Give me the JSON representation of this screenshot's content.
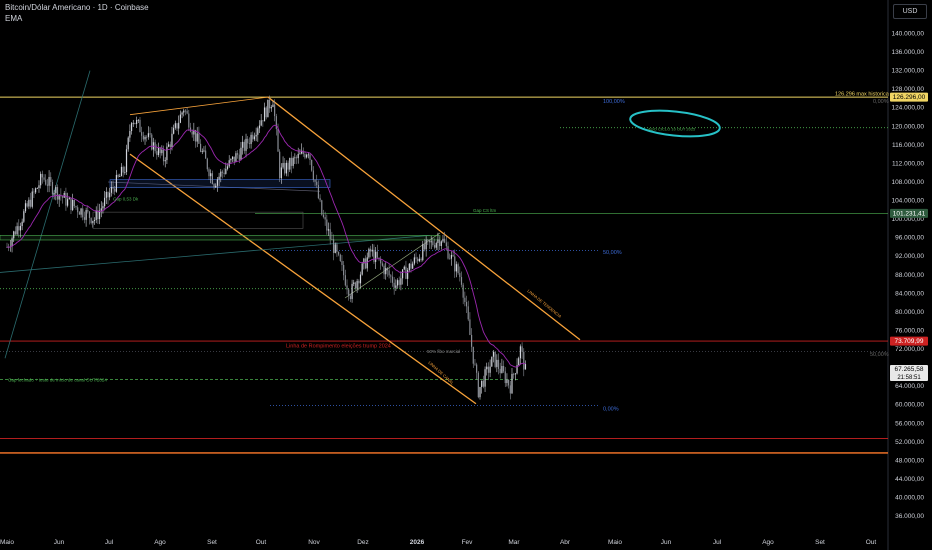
{
  "header": {
    "title": "Bitcoin/Dólar Americano · 1D · Coinbase",
    "indicator": "EMA",
    "currency": "USD"
  },
  "colors": {
    "background": "#000000",
    "up": "#d1d4dc",
    "down": "#8a8e96",
    "ema": "#9c27b0",
    "channel": "#f7a23a",
    "ath_line": "#f0d564",
    "resistance": "#cc2222",
    "support_low": "#ff7a2a",
    "green_level": "#4caf50",
    "blue_level": "#3d6bd6",
    "circle": "#27c1c7",
    "last_price_bg": "#2e5b3e"
  },
  "chart_data": {
    "type": "candlestick",
    "xlabels": [
      "Maio",
      "Jun",
      "Jul",
      "Ago",
      "Set",
      "Out",
      "Nov",
      "Dez",
      "2026",
      "Fev",
      "Mar",
      "Abr",
      "Maio",
      "Jun",
      "Jul",
      "Ago",
      "Set",
      "Out"
    ],
    "yticks": [
      "36.000,00",
      "40.000,00",
      "44.000,00",
      "48.000,00",
      "52.000,00",
      "56.000,00",
      "60.000,00",
      "64.000,00",
      "68.000,00",
      "72.000,00",
      "76.000,00",
      "80.000,00",
      "84.000,00",
      "88.000,00",
      "92.000,00",
      "96.000,00",
      "100.000,00",
      "104.000,00",
      "108.000,00",
      "112.000,00",
      "116.000,00",
      "120.000,00",
      "124.000,00",
      "128.000,00",
      "132.000,00",
      "136.000,00",
      "140.000,00"
    ],
    "ylim": [
      34000,
      142000
    ],
    "price_path": [
      [
        "2025-05-01",
        94000
      ],
      [
        "2025-05-22",
        109000
      ],
      [
        "2025-06-05",
        104000
      ],
      [
        "2025-06-22",
        100000
      ],
      [
        "2025-07-10",
        111000
      ],
      [
        "2025-07-14",
        122000
      ],
      [
        "2025-08-02",
        113000
      ],
      [
        "2025-08-14",
        124000
      ],
      [
        "2025-09-01",
        108000
      ],
      [
        "2025-09-20",
        116000
      ],
      [
        "2025-10-06",
        126000
      ],
      [
        "2025-10-10",
        110000
      ],
      [
        "2025-10-27",
        115000
      ],
      [
        "2025-11-04",
        101000
      ],
      [
        "2025-11-21",
        84000
      ],
      [
        "2025-12-03",
        93000
      ],
      [
        "2025-12-18",
        86000
      ],
      [
        "2026-01-05",
        94000
      ],
      [
        "2026-01-14",
        96000
      ],
      [
        "2026-01-26",
        87000
      ],
      [
        "2026-02-05",
        63000
      ],
      [
        "2026-02-14",
        70000
      ],
      [
        "2026-02-24",
        64000
      ],
      [
        "2026-03-02",
        72000
      ],
      [
        "2026-03-05",
        67265
      ]
    ],
    "last_price": "67.265,58",
    "countdown": "21:58:51",
    "price_labels": {
      "ath": "126.296,00",
      "level_101": "101.231,41",
      "level_73": "73.709,99"
    },
    "annotations": {
      "ath": "126.296 max historica",
      "fib_top": "100,00%",
      "fib_50": "50,00%",
      "fib_bottom": "0,00%",
      "fib_right": "0,00%",
      "fib_right_50": "50,00%",
      "gap_cme": "Gap CS ltm",
      "gap_small": "Gap 0,53 Dk",
      "ath_circle": "AGO CICLO 10 OUT 2025",
      "trendline": "LINHA DE TENDENCIA",
      "channel": "LINHA DE CANAL",
      "trump_line": "Linha de Rompimento eleições trump 2024",
      "fib_mid_left": "50% fibo marcial",
      "gap_closed": "Gap fechado + teste de início de canal OUT/2024"
    }
  }
}
